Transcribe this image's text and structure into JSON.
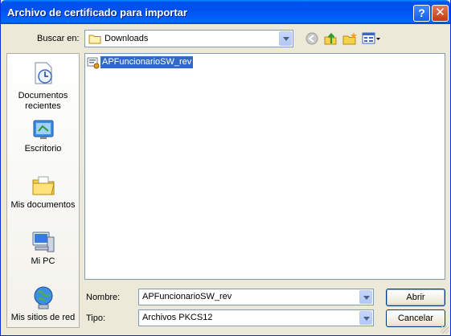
{
  "window": {
    "title": "Archivo de certificado para importar"
  },
  "toolbar": {
    "look_in_label": "Buscar en:",
    "look_in_value": "Downloads"
  },
  "places": [
    {
      "label_lines": [
        "Documentos",
        "recientes"
      ]
    },
    {
      "label_lines": [
        "Escritorio"
      ]
    },
    {
      "label_lines": [
        "Mis documentos"
      ]
    },
    {
      "label_lines": [
        "Mi PC"
      ]
    },
    {
      "label_lines": [
        "Mis sitios de red"
      ]
    }
  ],
  "files": [
    {
      "name": "APFuncionarioSW_rev",
      "selected": true
    }
  ],
  "form": {
    "name_label": "Nombre:",
    "name_value": "APFuncionarioSW_rev",
    "type_label": "Tipo:",
    "type_value": "Archivos PKCS12"
  },
  "buttons": {
    "open": "Abrir",
    "cancel": "Cancelar"
  },
  "colors": {
    "title_bar": "#0053ee",
    "dialog_bg": "#ece9d8",
    "selection": "#316ac5"
  }
}
